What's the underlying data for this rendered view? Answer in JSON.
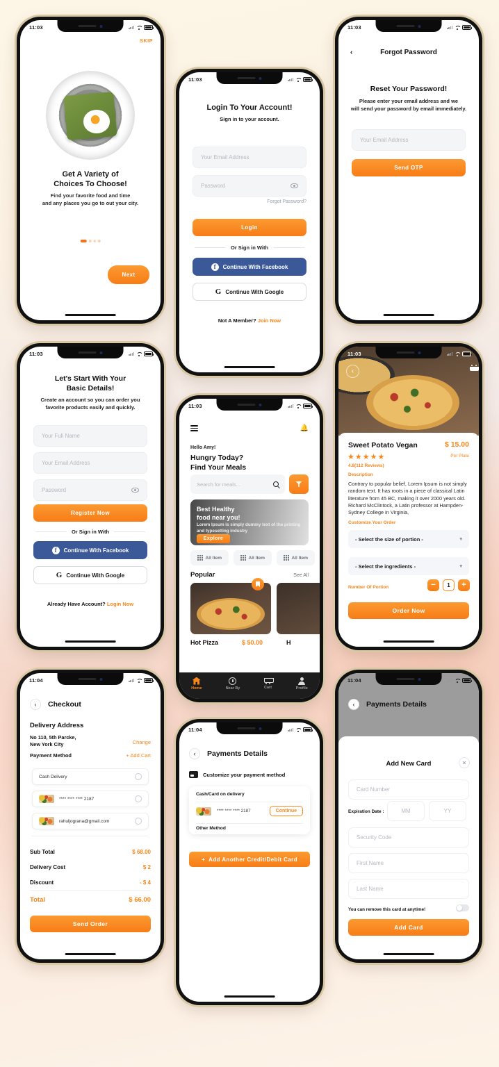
{
  "theme": {
    "accent": "#f8861a",
    "facebook_blue": "#3b5998",
    "dark_nav": "#1d1d1d"
  },
  "status_bars": {
    "time_early": "11:03",
    "time_late": "11:04"
  },
  "onboarding": {
    "skip": "SKIP",
    "title_line1": "Get A Variety of",
    "title_line2": "Choices To Choose!",
    "subtitle_line1": "Find your favorite food and time",
    "subtitle_line2": "and any places you go to out your city.",
    "next": "Next",
    "dot_count": 4,
    "active_dot": 1
  },
  "login": {
    "title": "Login To Your Account!",
    "subtitle": "Sign in to your account.",
    "email_placeholder": "Your Email Address",
    "password_placeholder": "Password",
    "forgot": "Forgot Password?",
    "login_button": "Login",
    "divider": "Or Sign in With",
    "facebook": "Continue With Facebook",
    "google": "Continue With Google",
    "footer_text": "Not A Member?",
    "footer_link": "Join Now"
  },
  "forgot": {
    "nav_title": "Forgot Password",
    "back": "‹",
    "title": "Reset Your Password!",
    "subtitle_line1": "Please enter your email address and we",
    "subtitle_line2": "will send your password by email immediately.",
    "email_placeholder": "Your Email Address",
    "send_otp": "Send OTP"
  },
  "register": {
    "title_line1": "Let's Start With Your",
    "title_line2": "Basic Details!",
    "subtitle_line1": "Create an account so you can order you",
    "subtitle_line2": "favorite products easily and quickly.",
    "name_placeholder": "Your Full Name",
    "email_placeholder": "Your Email Address",
    "password_placeholder": "Password",
    "register_button": "Register Now",
    "divider": "Or Sign in With",
    "facebook": "Continue With Facebook",
    "google": "Continue With Google",
    "footer_text": "Already Have Account?",
    "footer_link": "Login Now"
  },
  "home": {
    "greeting": "Hello Amy!",
    "headline_line1": "Hungry Today?",
    "headline_line2": "Find Your Meals",
    "search_placeholder": "Search for meals...",
    "banner": {
      "title_line1": "Best Healthy",
      "title_line2": "food near you!",
      "text": "Lorem Ipsum is simply dummy text of the printing and typesetting industry",
      "cta": "Explore"
    },
    "chips": [
      "All Item",
      "All Item",
      "All Item"
    ],
    "section_title": "Popular",
    "see_all": "See All",
    "items": [
      {
        "name": "Hot Pizza",
        "price": "$ 50.00"
      },
      {
        "name": "H"
      }
    ],
    "tabs": [
      {
        "label": "Home",
        "icon": "home-icon",
        "active": true
      },
      {
        "label": "Near By",
        "icon": "compass-icon",
        "active": false
      },
      {
        "label": "Cart",
        "icon": "cart-icon",
        "active": false
      },
      {
        "label": "Profile",
        "icon": "profile-icon",
        "active": false
      }
    ]
  },
  "detail": {
    "product_name": "Sweet Potato Vegan",
    "price": "$ 15.00",
    "per_plate": "Per Plate",
    "stars": "★★★★★",
    "rating_text": "4.8(112 Reviews)",
    "description_label": "Description",
    "description": "Contrary to popular belief, Lorem Ipsum is not simply random text. It has roots in a piece of classical Latin literature from 45 BC, making it over 2000 years old. Richard McClintock, a Latin professor at Hampden-Sydney College in Virginia,",
    "customize_label": "Customize Your Order",
    "select_size": "- Select the size of portion -",
    "select_ingredients": "- Select the ingredients -",
    "portion_label": "Number Of Portion",
    "portion_value": "1",
    "minus": "−",
    "plus": "+",
    "order_button": "Order Now"
  },
  "checkout": {
    "nav_title": "Checkout",
    "delivery_address_label": "Delivery Address",
    "address_line1": "No 110, 5th Parcke,",
    "address_line2": "New York City",
    "change": "Change",
    "payment_method_label": "Payment Method",
    "add_cart": "+ Add Cart",
    "methods": [
      {
        "label": "Cash Delivery",
        "has_thumb": false
      },
      {
        "label": "**** **** **** 2187",
        "has_thumb": true
      },
      {
        "label": "rahuljograna@gmail.com",
        "has_thumb": true
      }
    ],
    "summary": [
      {
        "key": "Sub Total",
        "value": "$ 68.00"
      },
      {
        "key": "Delivery Cost",
        "value": "$ 2"
      },
      {
        "key": "Discount",
        "value": "- $ 4"
      }
    ],
    "total_key": "Total",
    "total_value": "$ 66.00",
    "send_order": "Send Order"
  },
  "payments": {
    "nav_title": "Payments Details",
    "customize": "Customize your payment method",
    "panel_title": "Cash/Card on delivery",
    "card_number": "**** **** **** 2187",
    "continue": "Continue",
    "other_method": "Other Method",
    "add_another": "Add Another Credit/Debit Card",
    "plus": "+"
  },
  "addcard": {
    "nav_title": "Payments Details",
    "modal_title": "Add New Card",
    "close": "✕",
    "card_number_placeholder": "Card Number",
    "expiration_label": "Expiration Date :",
    "mm_placeholder": "MM",
    "yy_placeholder": "YY",
    "security_placeholder": "Security Code",
    "first_name_placeholder": "First Name",
    "last_name_placeholder": "Last Name",
    "remove_note": "You can remove this card at anytime!",
    "add_card": "Add Card"
  }
}
